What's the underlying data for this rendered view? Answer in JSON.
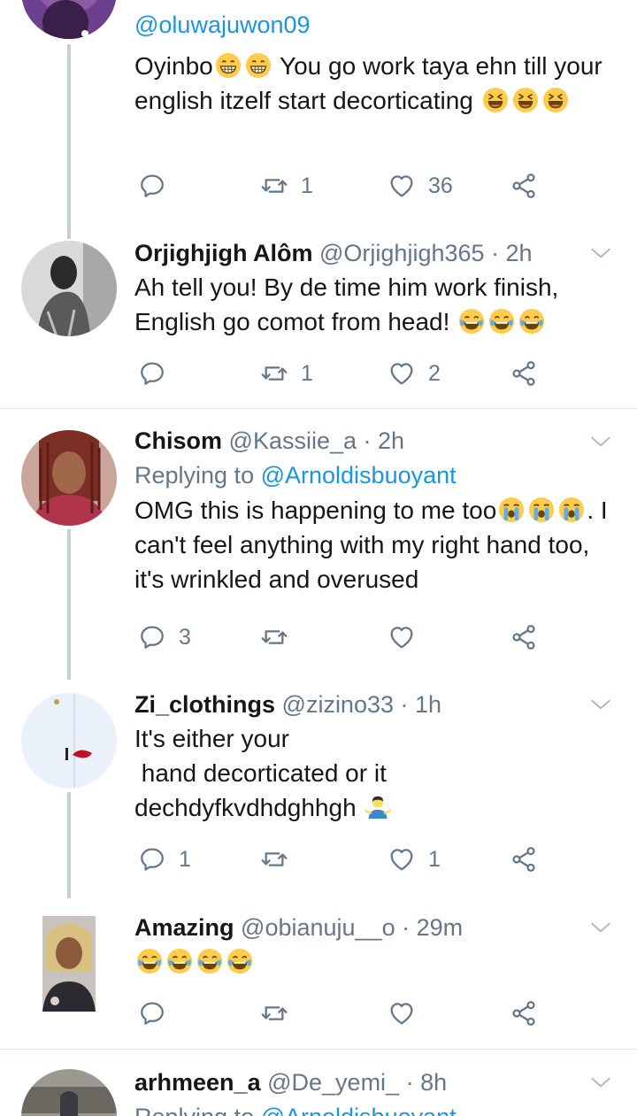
{
  "tweets": [
    {
      "handle": "@oluwajuwon09",
      "body": "Oyinbo",
      "body_emoji_1": [
        "grin",
        "grin"
      ],
      "body_rest": " You go work taya ehn till your english itzelf start decorticating ",
      "body_emoji_2": [
        "laugh",
        "laugh",
        "laugh"
      ],
      "replies": "",
      "retweets": "1",
      "likes": "36"
    },
    {
      "name": "Orjighjigh Alôm",
      "handle": "@Orjighjigh365",
      "time": "· 2h",
      "body": "Ah tell you! By de time him work finish, English go comot from head! ",
      "body_emoji": [
        "joy",
        "joy",
        "joy"
      ],
      "replies": "",
      "retweets": "1",
      "likes": "2"
    },
    {
      "name": "Chisom",
      "handle": "@Kassiie_a",
      "time": "· 2h",
      "replying_label": "Replying to ",
      "replying_to": "@Arnoldisbuoyant",
      "body": "OMG this is happening to me too",
      "body_emoji_1": [
        "cry",
        "cry",
        "cry"
      ],
      "body_rest": ". I can't feel anything with my right hand too, it's wrinkled and overused",
      "replies": "3",
      "retweets": "",
      "likes": ""
    },
    {
      "name": "Zi_clothings",
      "handle": "@zizino33",
      "time": "· 1h",
      "body": "It's either your\n hand decorticated or it dechdyfkvdhdghhgh ",
      "body_emoji": [
        "shrug"
      ],
      "replies": "1",
      "retweets": "",
      "likes": "1"
    },
    {
      "name": "Amazing",
      "handle": "@obianuju__o",
      "time": "· 29m",
      "body": "",
      "body_emoji": [
        "joy",
        "joy",
        "joy",
        "joy"
      ],
      "replies": "",
      "retweets": "",
      "likes": ""
    },
    {
      "name": "arhmeen_a",
      "handle": "@De_yemi_",
      "time": "· 8h",
      "replying_label": "Replying to ",
      "replying_to": "@Arnoldisbuoyant"
    }
  ],
  "icons": {
    "reply": "reply-icon",
    "retweet": "retweet-icon",
    "like": "heart-icon",
    "share": "share-icon",
    "more": "chevron-down-icon"
  },
  "colors": {
    "link": "#1b95e0",
    "muted": "#657786",
    "text": "#14171a",
    "thread_line": "#c4cfd6",
    "divider": "#e1e8ed"
  }
}
